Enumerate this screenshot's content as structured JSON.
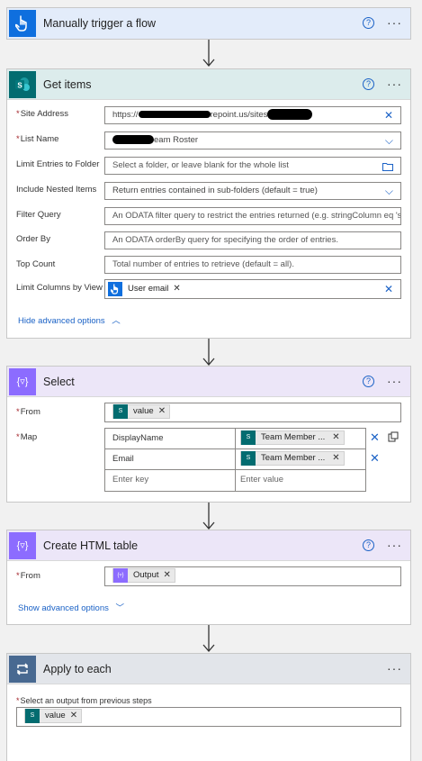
{
  "trigger": {
    "title": "Manually trigger a flow",
    "help": "?",
    "more": "···"
  },
  "get_items": {
    "title": "Get items",
    "help": "?",
    "more": "···",
    "site_address_label": "Site Address",
    "site_address_value_prefix": "https://",
    "site_address_value_mid": "repoint.us/sites",
    "list_name_label": "List Name",
    "list_name_value": "eam Roster",
    "limit_folder_label": "Limit Entries to Folder",
    "limit_folder_placeholder": "Select a folder, or leave blank for the whole list",
    "nested_label": "Include Nested Items",
    "nested_value": "Return entries contained in sub-folders (default = true)",
    "filter_label": "Filter Query",
    "filter_placeholder": "An ODATA filter query to restrict the entries returned (e.g. stringColumn eq 'stri",
    "order_label": "Order By",
    "order_placeholder": "An ODATA orderBy query for specifying the order of entries.",
    "top_label": "Top Count",
    "top_placeholder": "Total number of entries to retrieve (default = all).",
    "limit_cols_label": "Limit Columns by View",
    "limit_cols_chip": "User email",
    "advanced_link": "Hide advanced options"
  },
  "select": {
    "title": "Select",
    "help": "?",
    "more": "···",
    "from_label": "From",
    "from_chip": "value",
    "map_label": "Map",
    "map_rows": [
      {
        "key": "DisplayName",
        "value": "Team Member ..."
      },
      {
        "key": "Email",
        "value": "Team Member ..."
      }
    ],
    "key_placeholder": "Enter key",
    "value_placeholder": "Enter value"
  },
  "html_table": {
    "title": "Create HTML table",
    "help": "?",
    "more": "···",
    "from_label": "From",
    "from_chip": "Output",
    "advanced_link": "Show advanced options"
  },
  "apply_each": {
    "title": "Apply to each",
    "more": "···",
    "select_label": "Select an output from previous steps",
    "value_chip": "value"
  },
  "colors": {
    "accent": "#1b62c6",
    "sharepoint": "#036c70",
    "data_ops": "#8c6cff",
    "control": "#486991",
    "trigger": "#0f6fde"
  }
}
